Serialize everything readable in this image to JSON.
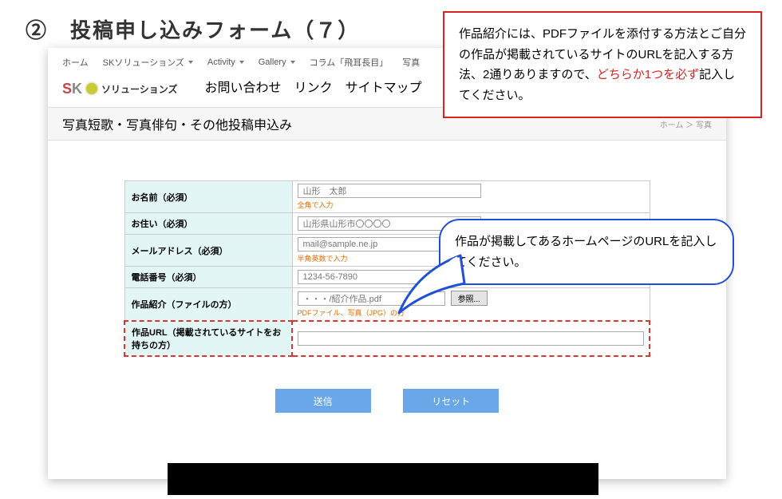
{
  "heading": "②　投稿申し込みフォーム（７）",
  "nav": {
    "row1": [
      "ホーム",
      "SKソリューションズ",
      "Activity",
      "Gallery",
      "コラム「飛耳長目」",
      "写真"
    ],
    "row2": [
      "お問い合わせ",
      "リンク",
      "サイトマップ"
    ]
  },
  "logo_text": "ソリューションズ",
  "page_title": "写真短歌・写真俳句・その他投稿申込み",
  "breadcrumb": "ホーム  ＞  写真",
  "form": {
    "name": {
      "label": "お名前（必須）",
      "value": "山形　太郎",
      "hint": "全角で入力"
    },
    "addr": {
      "label": "お住い（必須）",
      "value": "山形県山形市〇〇〇〇"
    },
    "mail": {
      "label": "メールアドレス（必須）",
      "value": "mail@sample.ne.jp",
      "hint": "半角英数で入力"
    },
    "tel": {
      "label": "電話番号（必須）",
      "value": "1234-56-7890"
    },
    "file": {
      "label": "作品紹介（ファイルの方）",
      "value": "・・・/紹介作品.pdf",
      "hint": "PDFファイル、写真（JPG）の方",
      "browse": "参照..."
    },
    "url": {
      "label": "作品URL（掲載されているサイトをお持ちの方）",
      "value": ""
    }
  },
  "buttons": {
    "submit": "送信",
    "reset": "リセット"
  },
  "callout_red_1": "作品紹介には、PDFファイルを添付する方法とご自分の作品が掲載されているサイトのURLを記入する方法、2通りありますので、",
  "callout_red_em": "どちらか1つを必ず",
  "callout_red_2": "記入してください。",
  "callout_blue": "作品が掲載してあるホームページのURLを記入してください。"
}
